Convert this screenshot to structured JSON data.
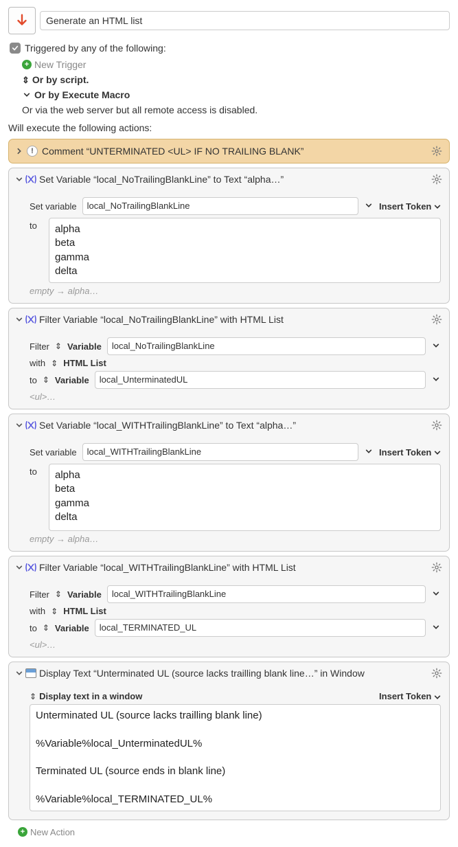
{
  "macro": {
    "title": "Generate an HTML list"
  },
  "triggers": {
    "triggeredBy": "Triggered by any of the following:",
    "newTrigger": "New Trigger",
    "orByScript": "Or by script.",
    "orByExecuteMacro": "Or by Execute Macro",
    "orViaWeb": "Or via the web server but all remote access is disabled."
  },
  "exec": {
    "willExecute": "Will execute the following actions:"
  },
  "actions": {
    "comment": {
      "title": "Comment “UNTERMINATED <UL> IF NO TRAILING BLANK”"
    },
    "setVar1": {
      "title": "Set Variable “local_NoTrailingBlankLine” to Text “alpha…”",
      "setVariableLabel": "Set variable",
      "variableName": "local_NoTrailingBlankLine",
      "insertToken": "Insert Token",
      "toLabel": "to",
      "textValue": "alpha\nbeta\ngamma\ndelta",
      "hintPrefix": "empty",
      "hintArrow": "→",
      "hintSuffix": "alpha…"
    },
    "filter1": {
      "title": "Filter Variable “local_NoTrailingBlankLine” with HTML List",
      "filterLabel": "Filter",
      "sourceTypeLabel": "Variable",
      "sourceVar": "local_NoTrailingBlankLine",
      "withLabel": "with",
      "withValue": "HTML List",
      "toLabel": "to",
      "destTypeLabel": "Variable",
      "destVar": "local_UnterminatedUL",
      "hint": "<ul>…"
    },
    "setVar2": {
      "title": "Set Variable “local_WITHTrailingBlankLine” to Text “alpha…”",
      "setVariableLabel": "Set variable",
      "variableName": "local_WITHTrailingBlankLine",
      "insertToken": "Insert Token",
      "toLabel": "to",
      "textValue": "alpha\nbeta\ngamma\ndelta",
      "hintPrefix": "empty",
      "hintArrow": "→",
      "hintSuffix": "alpha…"
    },
    "filter2": {
      "title": "Filter Variable “local_WITHTrailingBlankLine” with HTML List",
      "filterLabel": "Filter",
      "sourceTypeLabel": "Variable",
      "sourceVar": "local_WITHTrailingBlankLine",
      "withLabel": "with",
      "withValue": "HTML List",
      "toLabel": "to",
      "destTypeLabel": "Variable",
      "destVar": "local_TERMINATED_UL",
      "hint": "<ul>…"
    },
    "display": {
      "title": "Display Text “Unterminated UL (source lacks trailling blank line…” in Window",
      "modeLabel": "Display text in a window",
      "insertToken": "Insert Token",
      "body": "Unterminated UL (source lacks trailling blank line)\n\n%Variable%local_UnterminatedUL%\n\nTerminated UL (source ends in blank line)\n\n%Variable%local_TERMINATED_UL%"
    }
  },
  "newAction": "New Action"
}
